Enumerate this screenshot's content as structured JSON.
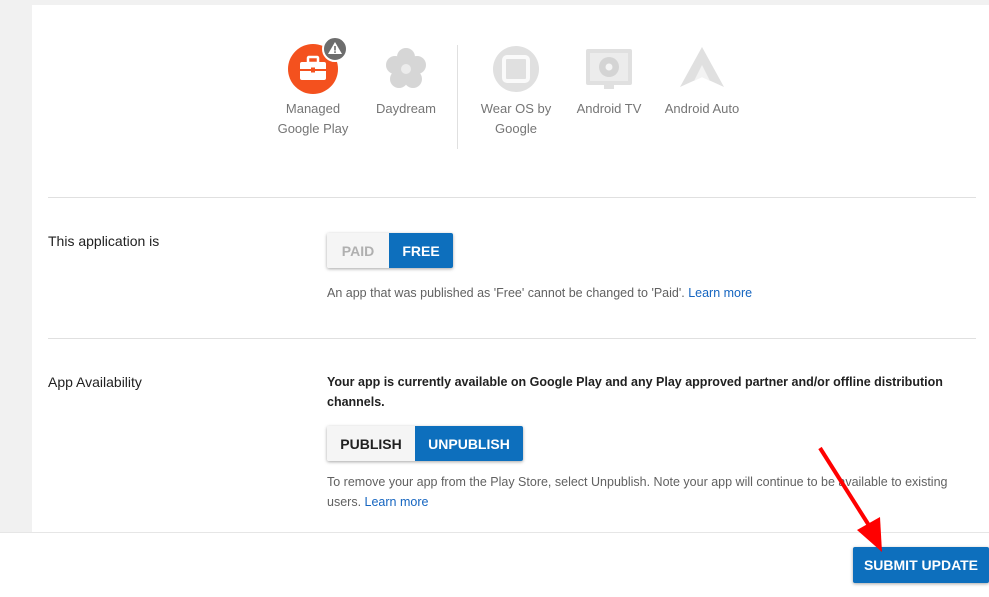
{
  "devices": [
    {
      "label": "Managed Google Play",
      "icon": "briefcase-icon",
      "warning": true
    },
    {
      "label": "Daydream",
      "icon": "daydream-icon"
    },
    {
      "label": "Wear OS by Google",
      "icon": "watch-icon"
    },
    {
      "label": "Android TV",
      "icon": "tv-icon"
    },
    {
      "label": "Android Auto",
      "icon": "car-icon"
    }
  ],
  "pricing": {
    "label": "This application is",
    "paid": "PAID",
    "free": "FREE",
    "selected": "FREE",
    "help": "An app that was published as 'Free' cannot be changed to 'Paid'.",
    "learn_more": "Learn more"
  },
  "availability": {
    "label": "App Availability",
    "status": "Your app is currently available on Google Play and any Play approved partner and/or offline distribution channels.",
    "publish": "PUBLISH",
    "unpublish": "UNPUBLISH",
    "selected": "UNPUBLISH",
    "help": "To remove your app from the Play Store, select Unpublish. Note your app will continue to be available to existing users.",
    "learn_more": "Learn more"
  },
  "submit_label": "SUBMIT UPDATE",
  "colors": {
    "accent": "#0d6fbd",
    "managed_play": "#f4511e",
    "annotation_arrow": "#ff0000"
  }
}
